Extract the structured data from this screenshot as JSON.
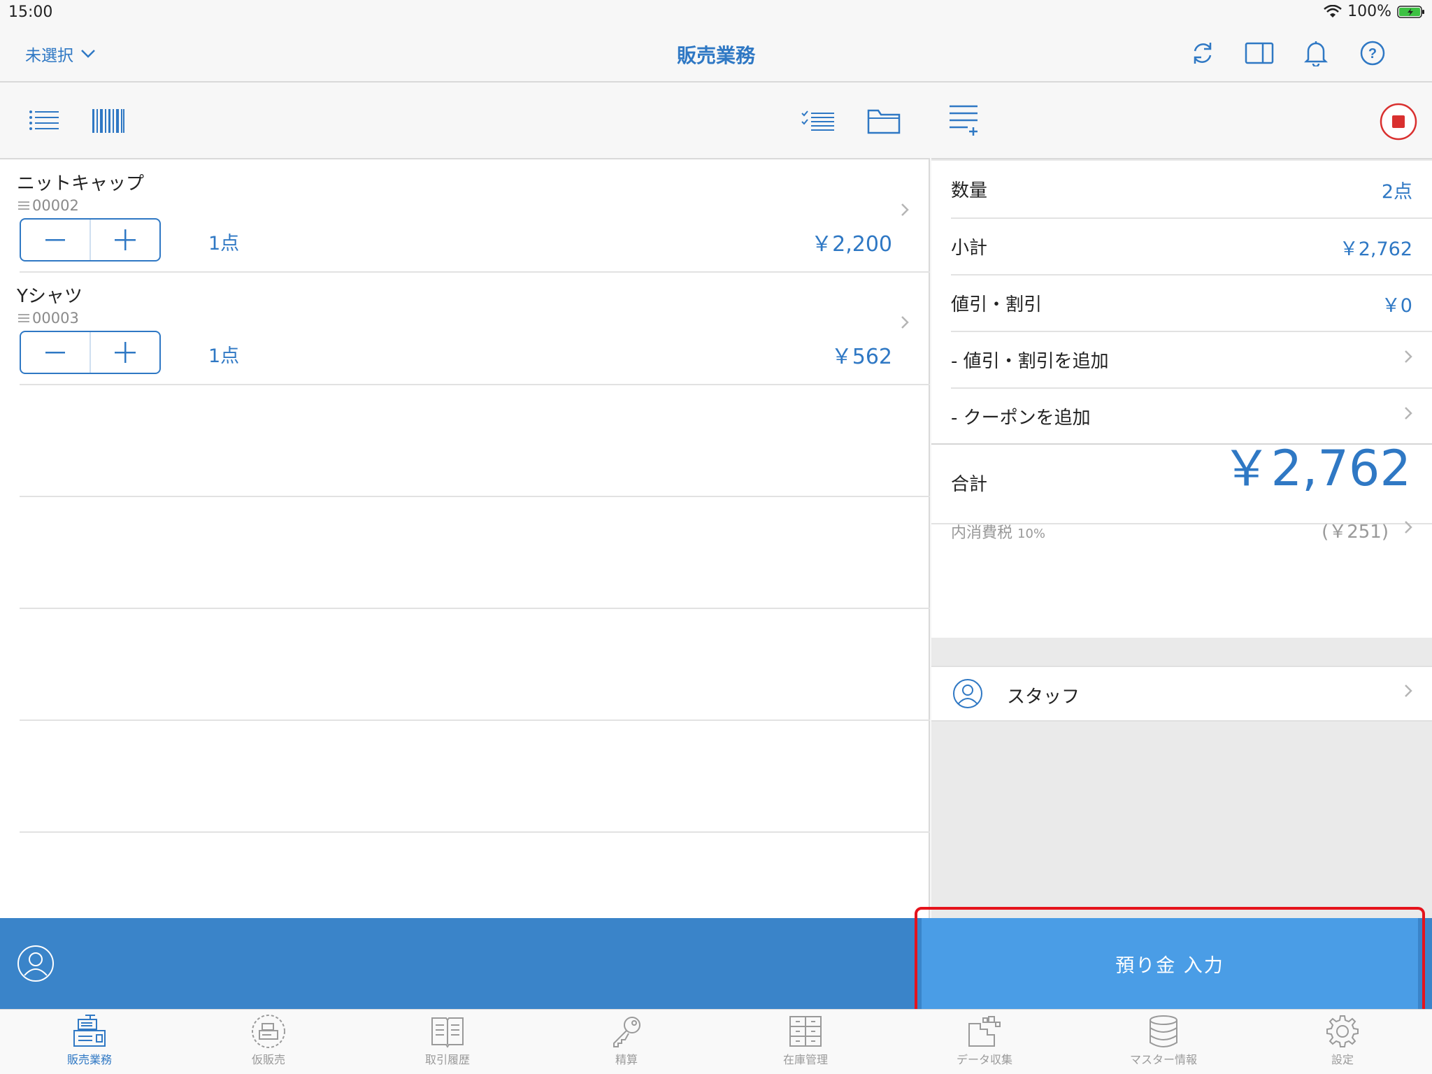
{
  "status": {
    "time": "15:00",
    "battery": "100%"
  },
  "nav": {
    "select_label": "未選択",
    "title": "販売業務",
    "icons": [
      "refresh-icon",
      "split-view-icon",
      "bell-icon",
      "help-icon"
    ]
  },
  "items": [
    {
      "name": "ニットキャップ",
      "code": "00002",
      "qty": "1点",
      "price": "￥2,200"
    },
    {
      "name": "Yシャツ",
      "code": "00003",
      "qty": "1点",
      "price": "￥562"
    }
  ],
  "summary": {
    "quantity_label": "数量",
    "quantity_value": "2点",
    "subtotal_label": "小計",
    "subtotal_value": "￥2,762",
    "discount_label": "値引・割引",
    "discount_value": "￥0",
    "add_discount_label": "- 値引・割引を追加",
    "add_coupon_label": "- クーポンを追加",
    "total_label": "合計",
    "total_value": "￥2,762",
    "tax_label": "内消費税",
    "tax_rate": "10%",
    "tax_value": "(￥251)",
    "staff_label": "スタッフ"
  },
  "action": {
    "deposit_label": "預り金 入力"
  },
  "tabs": [
    {
      "label": "販売業務",
      "active": true
    },
    {
      "label": "仮販売"
    },
    {
      "label": "取引履歴"
    },
    {
      "label": "精算"
    },
    {
      "label": "在庫管理"
    },
    {
      "label": "データ収集"
    },
    {
      "label": "マスター情報"
    },
    {
      "label": "設定"
    }
  ],
  "colors": {
    "accent": "#2f78c4",
    "action_bar": "#3a84c9",
    "deposit_button": "#4a9de6",
    "highlight": "#e5131c",
    "stop": "#d9302f"
  }
}
